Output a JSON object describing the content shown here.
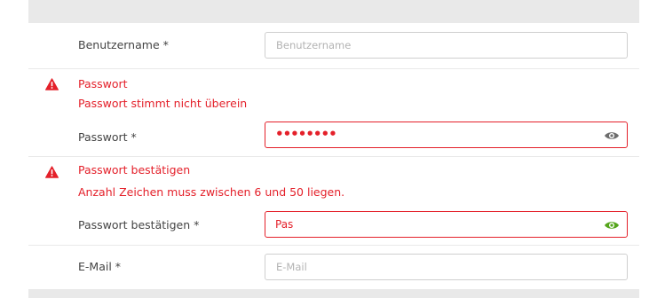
{
  "form": {
    "username": {
      "label": "Benutzername *",
      "placeholder": "Benutzername"
    },
    "password": {
      "error_title": "Passwort",
      "error_message": "Passwort stimmt nicht überein",
      "label": "Passwort *",
      "value_masked": "••••••••",
      "eye_icon": "eye-icon",
      "eye_color": "#6d6d6d"
    },
    "password_confirm": {
      "error_title": "Passwort bestätigen",
      "error_message": "Anzahl Zeichen muss zwischen 6 und 50 liegen.",
      "label": "Passwort bestätigen *",
      "value": "Pas",
      "eye_icon": "eye-icon",
      "eye_color": "#55a51c"
    },
    "email": {
      "label": "E-Mail *",
      "placeholder": "E-Mail"
    }
  },
  "colors": {
    "error": "#e4202a",
    "panel_background": "#e9e9e9",
    "input_border": "#cfcfcf"
  },
  "icons": {
    "warning": "warning-triangle-icon"
  }
}
